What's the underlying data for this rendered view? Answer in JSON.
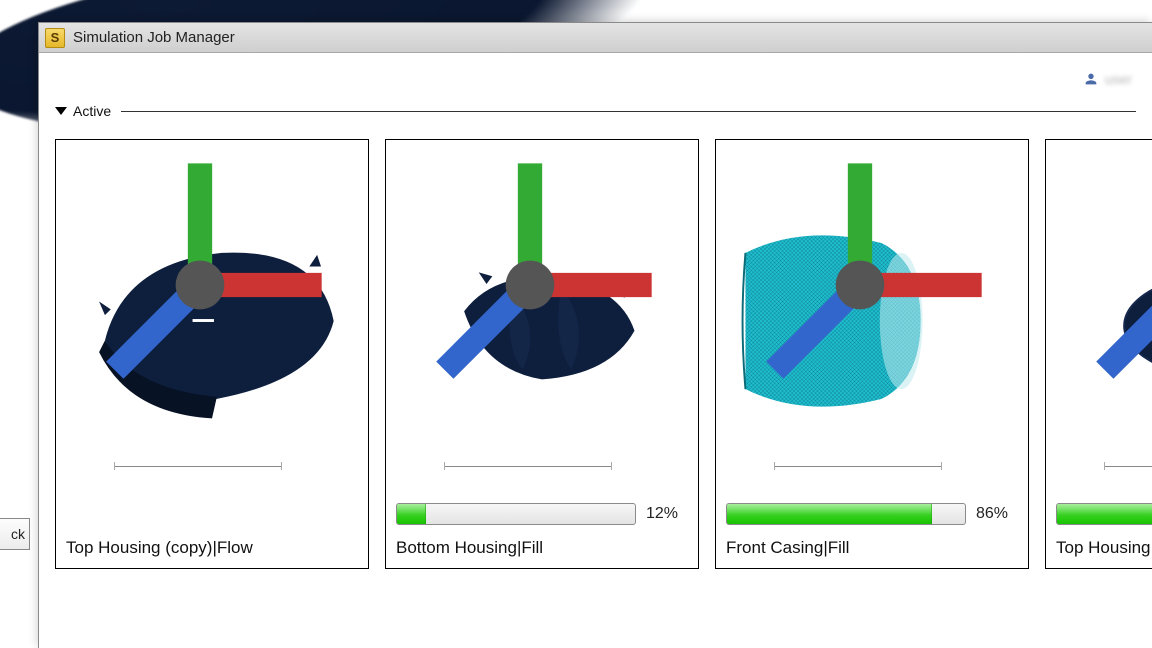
{
  "window": {
    "title": "Simulation Job Manager",
    "app_icon_letter": "S"
  },
  "user": {
    "label": "user"
  },
  "section": {
    "label": "Active"
  },
  "edge_button": {
    "label": "ck"
  },
  "jobs": [
    {
      "name": "Top Housing (copy)|Flow",
      "show_progress": false,
      "progress_pct": 0,
      "pct_label": ""
    },
    {
      "name": "Bottom Housing|Fill",
      "show_progress": true,
      "progress_pct": 12,
      "pct_label": "12%"
    },
    {
      "name": "Front Casing|Fill",
      "show_progress": true,
      "progress_pct": 86,
      "pct_label": "86%"
    },
    {
      "name": "Top Housing",
      "show_progress": true,
      "progress_pct": 100,
      "pct_label": ""
    }
  ],
  "colors": {
    "mesh_dark": "#0e1e3d",
    "mesh_cyan": "#1fbecf",
    "progress_green": "#17c400"
  }
}
